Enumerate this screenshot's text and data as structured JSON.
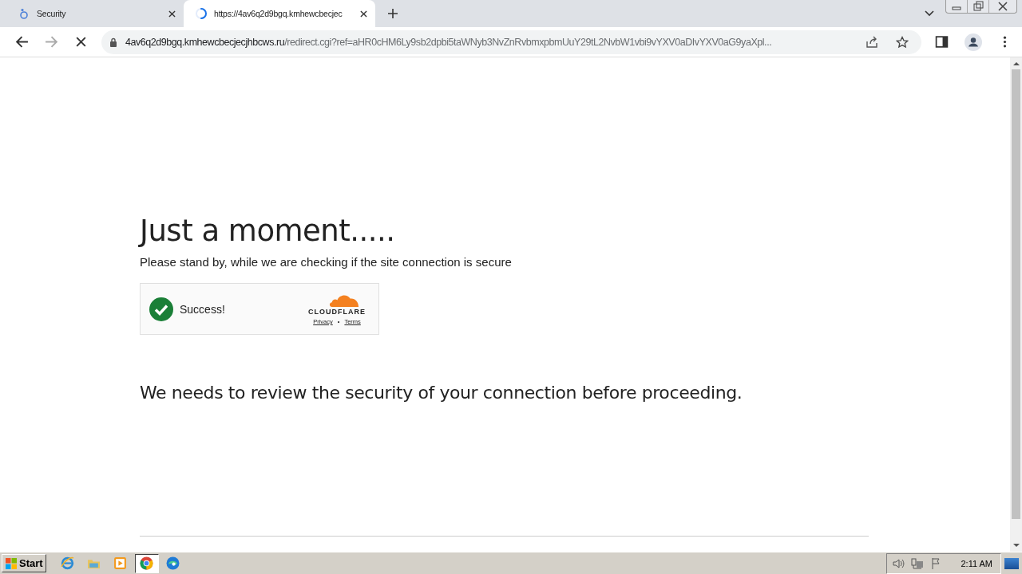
{
  "tabs": [
    {
      "title": "Security",
      "selected": false,
      "kind": "site"
    },
    {
      "title": "https://4av6q2d9bgq.kmhewcbecjec",
      "selected": true,
      "kind": "loading"
    }
  ],
  "address": {
    "host": "4av6q2d9bgq.kmhewcbecjecjhbcws.ru",
    "path": "/redirect.cgi?ref=aHR0cHM6Ly9sb2dpbi5taWNyb3NvZnRvbmxpbmUuY29tL2NvbW1vbi9vYXV0aDIvYXV0aG9yaXpl..."
  },
  "page": {
    "title": "Just a moment.....",
    "subtitle": "Please stand by, while we are checking if the site connection is secure",
    "widget": {
      "status": "Success!",
      "brand": "CLOUDFLARE",
      "links": [
        "Privacy",
        "Terms"
      ],
      "separator": "•"
    },
    "message": "We needs to review the security of your connection before proceeding."
  },
  "taskbar": {
    "start": "Start",
    "apps": [
      {
        "kind": "ie",
        "selected": false
      },
      {
        "kind": "folder",
        "selected": false
      },
      {
        "kind": "media",
        "selected": false
      },
      {
        "kind": "chrome",
        "selected": true
      },
      {
        "kind": "edge",
        "selected": false
      }
    ],
    "clock": "2:11 AM"
  }
}
